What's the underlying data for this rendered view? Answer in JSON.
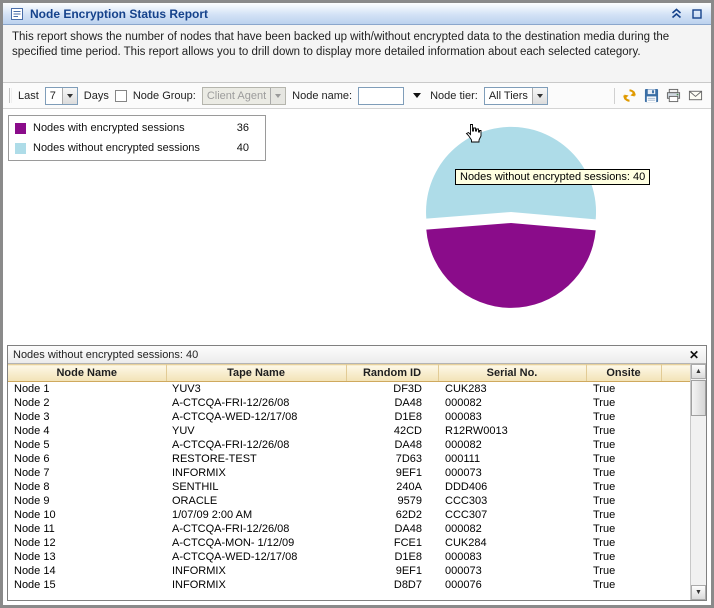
{
  "title_bar": {
    "title": "Node Encryption Status Report"
  },
  "description": "This report shows the number of nodes that have been backed up with/without encrypted data to the destination media during the specified time period. This report allows you to drill down to display more detailed information about each selected category.",
  "toolbar": {
    "last_label": "Last",
    "days_value": "7",
    "days_label": "Days",
    "node_group_label": "Node Group:",
    "node_group_value": "Client Agent",
    "node_name_label": "Node name:",
    "node_name_value": "",
    "node_tier_label": "Node tier:",
    "node_tier_value": "All Tiers"
  },
  "legend": {
    "items": [
      {
        "label": "Nodes with encrypted sessions",
        "value": "36",
        "color": "#8A0C8A"
      },
      {
        "label": "Nodes without encrypted sessions",
        "value": "40",
        "color": "#AEDCE8"
      }
    ]
  },
  "chart_data": {
    "type": "pie",
    "title": "",
    "categories": [
      "Nodes with encrypted sessions",
      "Nodes without encrypted sessions"
    ],
    "values": [
      36,
      40
    ],
    "colors": [
      "#8A0C8A",
      "#AEDCE8"
    ],
    "start_angle": 5,
    "exploded_index": 1,
    "legend_position": "top-left",
    "tooltip": "Nodes without encrypted sessions: 40"
  },
  "icons": {
    "scroll_up": "▲",
    "scroll_down": "▼"
  },
  "detail_panel": {
    "title": "Nodes without encrypted sessions: 40",
    "close_label": "✕",
    "table": {
      "headers": [
        "Node Name",
        "Tape Name",
        "Random ID",
        "Serial No.",
        "Onsite"
      ],
      "rows": [
        [
          "Node 1",
          "YUV3",
          "DF3D",
          "CUK283",
          "True"
        ],
        [
          "Node 2",
          "A-CTCQA-FRI-12/26/08",
          "DA48",
          "000082",
          "True"
        ],
        [
          "Node 3",
          "A-CTCQA-WED-12/17/08",
          "D1E8",
          "000083",
          "True"
        ],
        [
          "Node 4",
          "YUV",
          "42CD",
          "R12RW0013",
          "True"
        ],
        [
          "Node 5",
          "A-CTCQA-FRI-12/26/08",
          "DA48",
          "000082",
          "True"
        ],
        [
          "Node 6",
          "RESTORE-TEST",
          "7D63",
          "000111",
          "True"
        ],
        [
          "Node 7",
          "INFORMIX",
          "9EF1",
          "000073",
          "True"
        ],
        [
          "Node 8",
          "SENTHIL",
          "240A",
          "DDD406",
          "True"
        ],
        [
          "Node 9",
          "ORACLE",
          "9579",
          "CCC303",
          "True"
        ],
        [
          "Node 10",
          "1/07/09 2:00 AM",
          "62D2",
          "CCC307",
          "True"
        ],
        [
          "Node 11",
          "A-CTCQA-FRI-12/26/08",
          "DA48",
          "000082",
          "True"
        ],
        [
          "Node 12",
          "A-CTCQA-MON- 1/12/09",
          "FCE1",
          "CUK284",
          "True"
        ],
        [
          "Node 13",
          "A-CTCQA-WED-12/17/08",
          "D1E8",
          "000083",
          "True"
        ],
        [
          "Node 14",
          "INFORMIX",
          "9EF1",
          "000073",
          "True"
        ],
        [
          "Node 15",
          "INFORMIX",
          "D8D7",
          "000076",
          "True"
        ]
      ]
    }
  }
}
